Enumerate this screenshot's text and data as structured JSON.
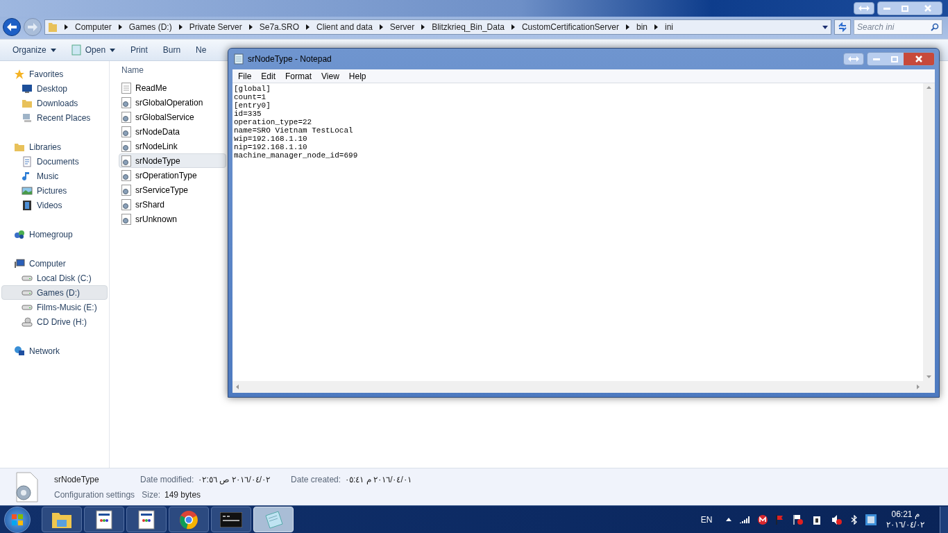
{
  "explorer": {
    "breadcrumbs": [
      "Computer",
      "Games (D:)",
      "Private Server",
      "Se7a.SRO",
      "Client and data",
      "Server",
      "Blitzkrieq_Bin_Data",
      "CustomCertificationServer",
      "bin",
      "ini"
    ],
    "search": {
      "placeholder": "Search ini"
    },
    "toolbar": [
      {
        "label": "Organize",
        "kind": "menu"
      },
      {
        "label": "Open",
        "kind": "open"
      },
      {
        "label": "Print",
        "kind": "plain"
      },
      {
        "label": "Burn",
        "kind": "plain"
      },
      {
        "label": "Ne",
        "kind": "plain"
      }
    ],
    "nav": [
      {
        "label": "Favorites",
        "kind": "star",
        "children": [
          {
            "label": "Desktop",
            "kind": "desktop",
            "selected": false
          },
          {
            "label": "Downloads",
            "kind": "folder",
            "selected": false
          },
          {
            "label": "Recent Places",
            "kind": "recent",
            "selected": false
          }
        ]
      },
      {
        "label": "Libraries",
        "kind": "library",
        "children": [
          {
            "label": "Documents",
            "kind": "doc",
            "selected": false
          },
          {
            "label": "Music",
            "kind": "music",
            "selected": false
          },
          {
            "label": "Pictures",
            "kind": "pictures",
            "selected": false
          },
          {
            "label": "Videos",
            "kind": "videos",
            "selected": false
          }
        ]
      },
      {
        "label": "Homegroup",
        "kind": "homegroup"
      },
      {
        "label": "Computer",
        "kind": "computer",
        "children": [
          {
            "label": "Local Disk (C:)",
            "kind": "drive",
            "selected": false
          },
          {
            "label": "Games (D:)",
            "kind": "drive",
            "selected": true
          },
          {
            "label": "Films-Music (E:)",
            "kind": "drive",
            "selected": false
          },
          {
            "label": "CD Drive (H:)",
            "kind": "cd",
            "selected": false
          }
        ]
      },
      {
        "label": "Network",
        "kind": "network"
      }
    ],
    "column": "Name",
    "files": [
      {
        "name": "ReadMe",
        "kind": "text",
        "selected": false
      },
      {
        "name": "srGlobalOperation",
        "kind": "config",
        "selected": false
      },
      {
        "name": "srGlobalService",
        "kind": "config",
        "selected": false
      },
      {
        "name": "srNodeData",
        "kind": "config",
        "selected": false
      },
      {
        "name": "srNodeLink",
        "kind": "config",
        "selected": false
      },
      {
        "name": "srNodeType",
        "kind": "config",
        "selected": true
      },
      {
        "name": "srOperationType",
        "kind": "config",
        "selected": false
      },
      {
        "name": "srServiceType",
        "kind": "config",
        "selected": false
      },
      {
        "name": "srShard",
        "kind": "config",
        "selected": false
      },
      {
        "name": "srUnknown",
        "kind": "config",
        "selected": false
      }
    ],
    "details": {
      "name": "srNodeType",
      "type": "Configuration settings",
      "modified_label": "Date modified:",
      "modified": "٢٠١٦/٠٤/٠٢ ص ٠٢:٥٦",
      "created_label": "Date created:",
      "created": "٢٠١٦/٠٤/٠١ م ٠٥:٤١",
      "size_label": "Size:",
      "size": "149 bytes"
    }
  },
  "notepad": {
    "title": "srNodeType - Notepad",
    "menu": [
      "File",
      "Edit",
      "Format",
      "View",
      "Help"
    ],
    "lines": [
      "[global]",
      "count=1",
      "[entry0]",
      "id=335",
      "operation_type=22",
      "name=SRO Vietnam TestLocal",
      "wip=192.168.1.10",
      "nip=192.168.1.10",
      "machine_manager_node_id=699"
    ]
  },
  "taskbar": {
    "apps": [
      {
        "kind": "explorer",
        "selected": false
      },
      {
        "kind": "app",
        "selected": false
      },
      {
        "kind": "app",
        "selected": false
      },
      {
        "kind": "browser",
        "selected": false
      },
      {
        "kind": "console",
        "selected": false
      },
      {
        "kind": "notepad",
        "selected": true
      }
    ],
    "language": "EN",
    "time": "06:21 م",
    "date": "٢٠١٦/٠٤/٠٢"
  }
}
